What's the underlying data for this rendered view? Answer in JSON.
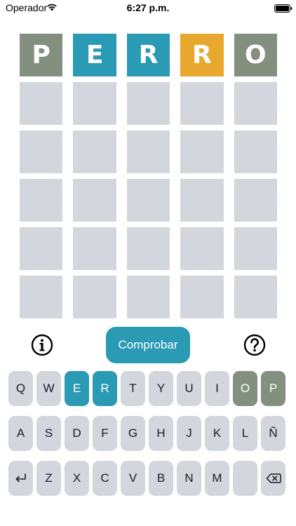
{
  "status_bar": {
    "carrier": "Operador",
    "time": "6:27 p.m."
  },
  "colors": {
    "correct": "#2a9ab5",
    "present": "#e8a82e",
    "absent": "#83907f",
    "empty": "#d3d6dd",
    "accent": "#2a9ab5"
  },
  "board": {
    "rows": [
      [
        {
          "letter": "P",
          "state": "absent"
        },
        {
          "letter": "E",
          "state": "correct"
        },
        {
          "letter": "R",
          "state": "correct"
        },
        {
          "letter": "R",
          "state": "present"
        },
        {
          "letter": "O",
          "state": "absent"
        }
      ],
      [
        {
          "letter": "",
          "state": "empty"
        },
        {
          "letter": "",
          "state": "empty"
        },
        {
          "letter": "",
          "state": "empty"
        },
        {
          "letter": "",
          "state": "empty"
        },
        {
          "letter": "",
          "state": "empty"
        }
      ],
      [
        {
          "letter": "",
          "state": "empty"
        },
        {
          "letter": "",
          "state": "empty"
        },
        {
          "letter": "",
          "state": "empty"
        },
        {
          "letter": "",
          "state": "empty"
        },
        {
          "letter": "",
          "state": "empty"
        }
      ],
      [
        {
          "letter": "",
          "state": "empty"
        },
        {
          "letter": "",
          "state": "empty"
        },
        {
          "letter": "",
          "state": "empty"
        },
        {
          "letter": "",
          "state": "empty"
        },
        {
          "letter": "",
          "state": "empty"
        }
      ],
      [
        {
          "letter": "",
          "state": "empty"
        },
        {
          "letter": "",
          "state": "empty"
        },
        {
          "letter": "",
          "state": "empty"
        },
        {
          "letter": "",
          "state": "empty"
        },
        {
          "letter": "",
          "state": "empty"
        }
      ],
      [
        {
          "letter": "",
          "state": "empty"
        },
        {
          "letter": "",
          "state": "empty"
        },
        {
          "letter": "",
          "state": "empty"
        },
        {
          "letter": "",
          "state": "empty"
        },
        {
          "letter": "",
          "state": "empty"
        }
      ]
    ]
  },
  "actions": {
    "info_icon": "info-icon",
    "check_label": "Comprobar",
    "help_icon": "question-icon"
  },
  "keyboard": {
    "rows": [
      [
        {
          "label": "Q",
          "state": "default"
        },
        {
          "label": "W",
          "state": "default"
        },
        {
          "label": "E",
          "state": "correct"
        },
        {
          "label": "R",
          "state": "correct"
        },
        {
          "label": "T",
          "state": "default"
        },
        {
          "label": "Y",
          "state": "default"
        },
        {
          "label": "U",
          "state": "default"
        },
        {
          "label": "I",
          "state": "default"
        },
        {
          "label": "O",
          "state": "absent"
        },
        {
          "label": "P",
          "state": "absent"
        }
      ],
      [
        {
          "label": "A",
          "state": "default"
        },
        {
          "label": "S",
          "state": "default"
        },
        {
          "label": "D",
          "state": "default"
        },
        {
          "label": "F",
          "state": "default"
        },
        {
          "label": "G",
          "state": "default"
        },
        {
          "label": "H",
          "state": "default"
        },
        {
          "label": "J",
          "state": "default"
        },
        {
          "label": "K",
          "state": "default"
        },
        {
          "label": "L",
          "state": "default"
        },
        {
          "label": "Ñ",
          "state": "default"
        }
      ],
      [
        {
          "label": "",
          "icon": "enter-icon",
          "state": "default"
        },
        {
          "label": "Z",
          "state": "default"
        },
        {
          "label": "X",
          "state": "default"
        },
        {
          "label": "C",
          "state": "default"
        },
        {
          "label": "V",
          "state": "default"
        },
        {
          "label": "B",
          "state": "default"
        },
        {
          "label": "N",
          "state": "default"
        },
        {
          "label": "M",
          "state": "default"
        },
        {
          "label": "",
          "state": "default"
        },
        {
          "label": "",
          "icon": "backspace-icon",
          "state": "default"
        }
      ]
    ]
  }
}
